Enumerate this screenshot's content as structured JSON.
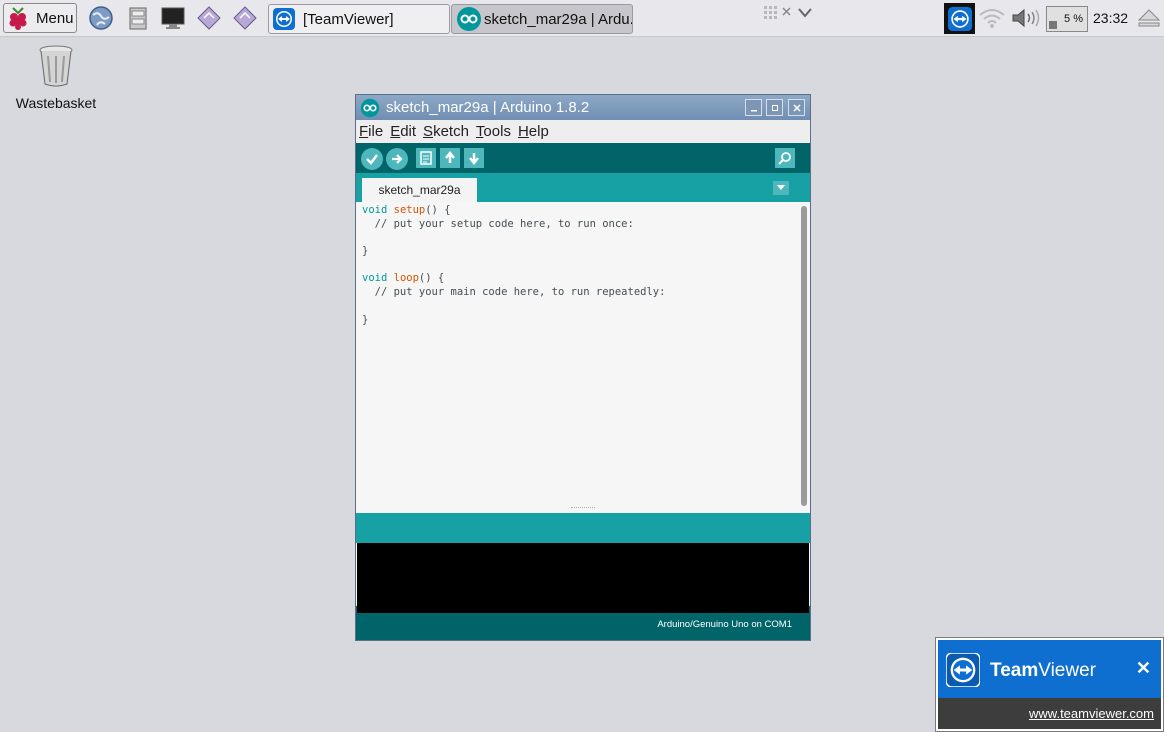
{
  "taskbar": {
    "menu_label": "Menu",
    "tasks": [
      {
        "label": "[TeamViewer]"
      },
      {
        "label": "sketch_mar29a | Ardu..."
      }
    ],
    "cpu_label": "5 %",
    "clock": "23:32"
  },
  "desktop": {
    "wastebasket_label": "Wastebasket"
  },
  "arduino": {
    "title": "sketch_mar29a | Arduino 1.8.2",
    "menu": [
      "File",
      "Edit",
      "Sketch",
      "Tools",
      "Help"
    ],
    "tab_label": "sketch_mar29a",
    "code": {
      "l1_kw": "void",
      "l1_fn": "setup",
      "l1_rest": "() {",
      "l2": "  // put your setup code here, to run once:",
      "l3": "",
      "l4": "}",
      "l5": "",
      "l6_kw": "void",
      "l6_fn": "loop",
      "l6_rest": "() {",
      "l7": "  // put your main code here, to run repeatedly:",
      "l8": "",
      "l9": "}"
    },
    "status": "Arduino/Genuino Uno on COM1"
  },
  "teamviewer_popup": {
    "brand_bold": "Team",
    "brand_rest": "Viewer",
    "close": "✕",
    "link": "www.teamviewer.com"
  },
  "colors": {
    "arduino_dark": "#006468",
    "arduino_teal": "#17a1a5",
    "teamviewer_blue": "#0e6fd0"
  }
}
